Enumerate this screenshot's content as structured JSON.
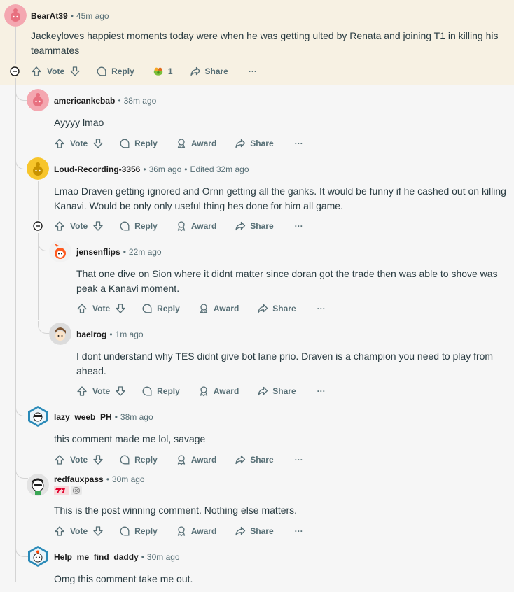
{
  "comments": [
    {
      "user": "BearAt39",
      "time": "45m ago",
      "edited": "",
      "text": "Jackeyloves happiest moments today were when he was getting ulted by Renata and joining T1 in killing his teammates",
      "award_count": "1"
    },
    {
      "user": "americankebab",
      "time": "38m ago",
      "edited": "",
      "text": "Ayyyy lmao"
    },
    {
      "user": "Loud-Recording-3356",
      "time": "36m ago",
      "edited": "Edited 32m ago",
      "text": "Lmao Draven getting ignored and Ornn getting all the ganks. It would be funny if he cashed out on killing Kanavi. Would be only only useful thing hes done for him all game."
    },
    {
      "user": "jensenflips",
      "time": "22m ago",
      "edited": "",
      "text": "That one dive on Sion where it didnt matter since doran got the trade then was able to shove was peak a Kanavi moment."
    },
    {
      "user": "baelrog",
      "time": "1m ago",
      "edited": "",
      "text": "I dont understand why TES didnt give bot lane prio. Draven is a champion you need to play from ahead."
    },
    {
      "user": "lazy_weeb_PH",
      "time": "38m ago",
      "edited": "",
      "text": "this comment made me lol, savage"
    },
    {
      "user": "redfauxpass",
      "time": "30m ago",
      "edited": "",
      "text": "This is the post winning comment. Nothing else matters."
    },
    {
      "user": "Help_me_find_daddy",
      "time": "30m ago",
      "edited": "",
      "text": "Omg this comment take me out."
    }
  ],
  "labels": {
    "vote": "Vote",
    "reply": "Reply",
    "award": "Award",
    "share": "Share",
    "more": "···"
  },
  "icons": [
    "upvote-icon",
    "downvote-icon",
    "reply-icon",
    "award-icon",
    "share-icon",
    "more-icon",
    "collapse-icon"
  ],
  "colors": {
    "highlight": "#f7f1e3",
    "meta": "#576f76",
    "body": "#2a3c42",
    "thread_line": "#d4d4d4"
  }
}
